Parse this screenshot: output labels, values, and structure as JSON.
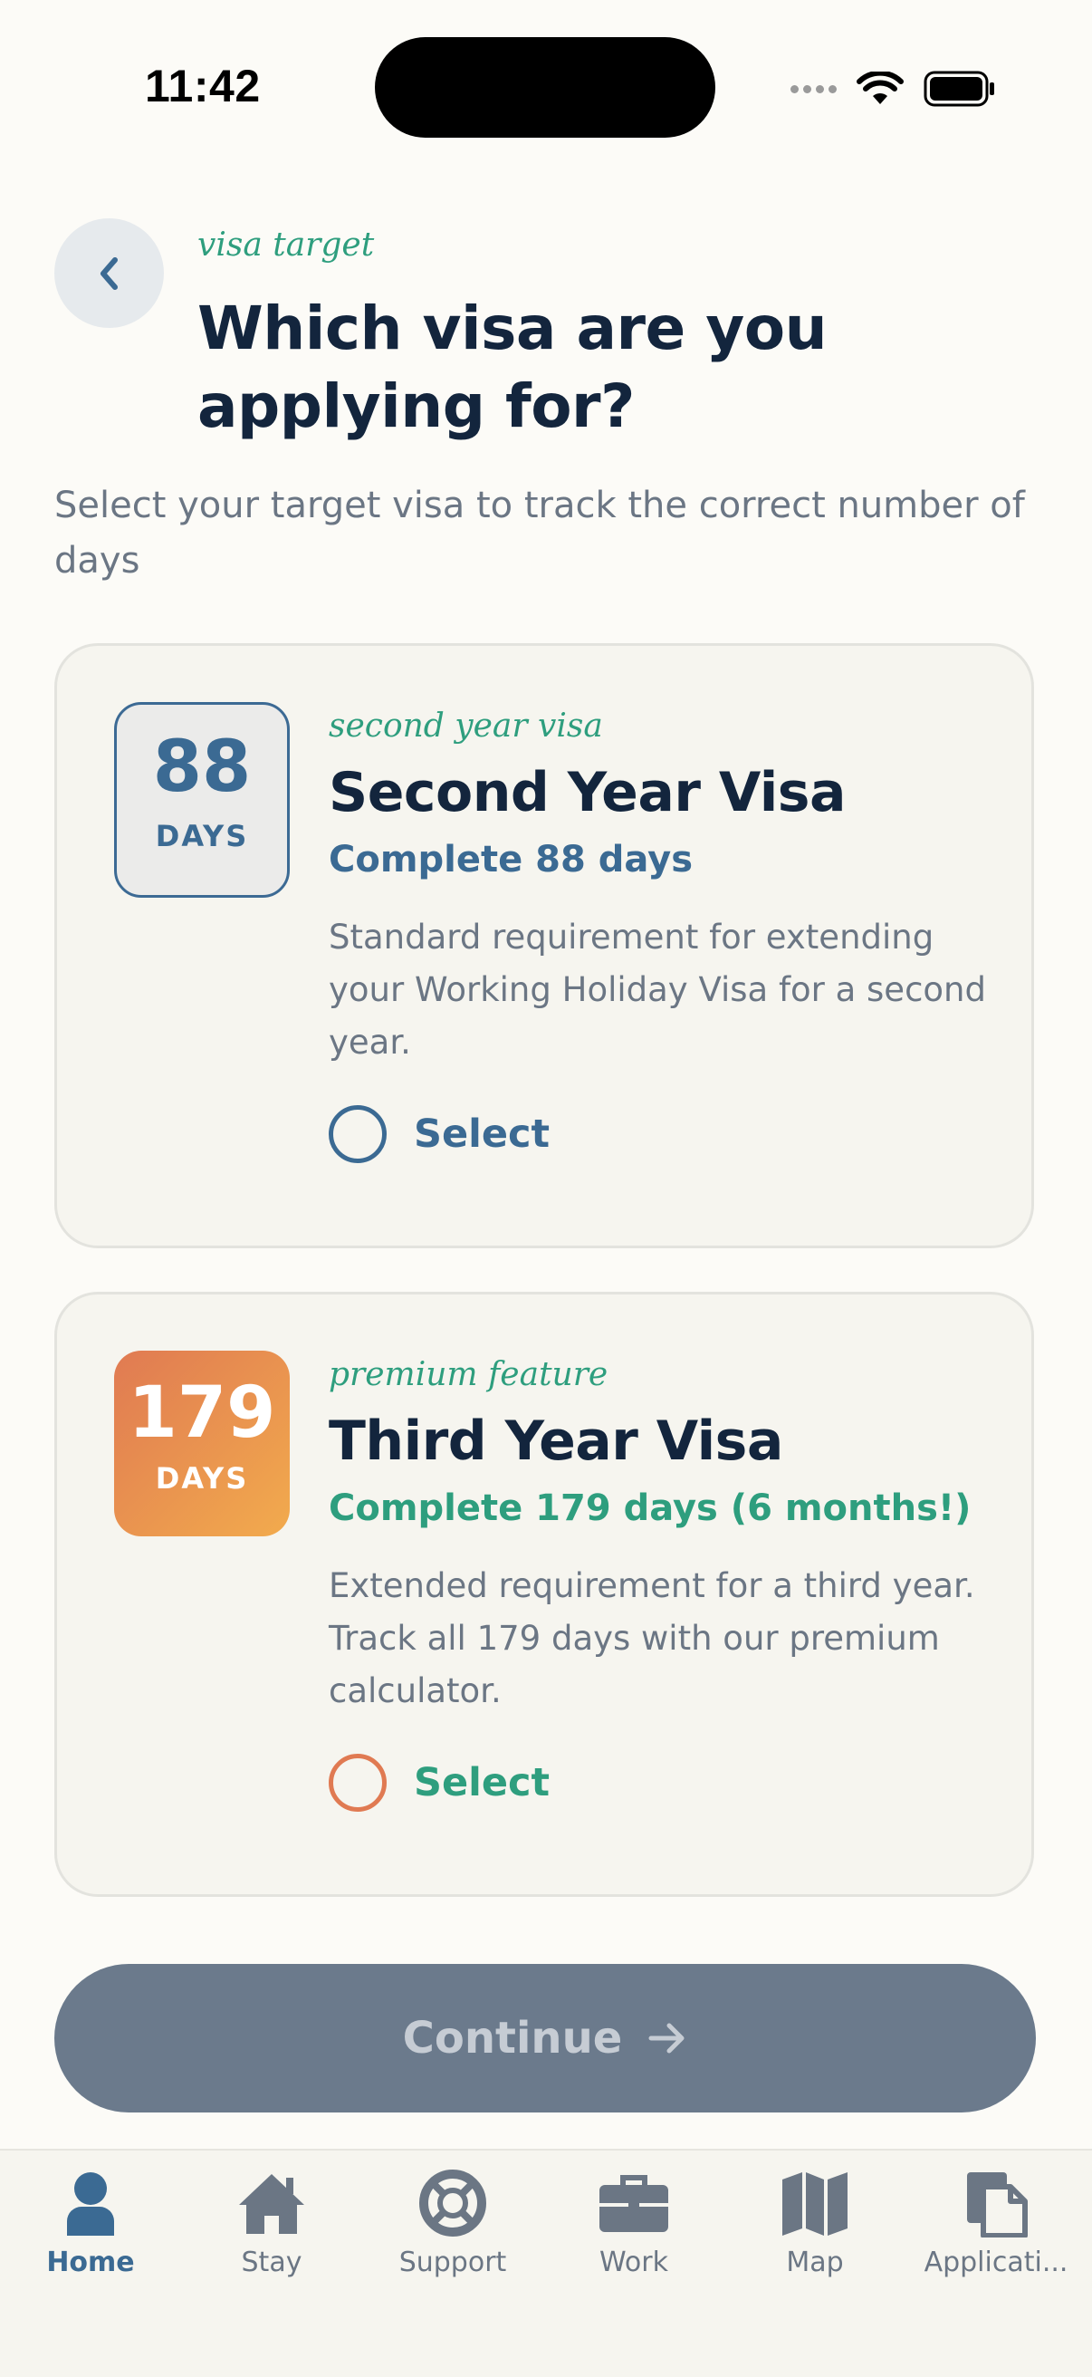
{
  "status_bar": {
    "time": "11:42"
  },
  "header": {
    "eyebrow": "visa target",
    "title": "Which visa are you applying for?",
    "subtitle": "Select your target visa to track the correct number of days"
  },
  "cards": [
    {
      "badge_number": "88",
      "badge_unit": "DAYS",
      "eyebrow": "second year visa",
      "title": "Second Year Visa",
      "requirement": "Complete 88 days",
      "description": "Standard requirement for extending your Working Holiday Visa for a second year.",
      "select_label": "Select",
      "selected": false
    },
    {
      "badge_number": "179",
      "badge_unit": "DAYS",
      "eyebrow": "premium feature",
      "title": "Third Year Visa",
      "requirement": "Complete 179 days (6 months!)",
      "description": "Extended requirement for a third year. Track all 179 days with our premium calculator.",
      "select_label": "Select",
      "selected": false
    }
  ],
  "continue_button": {
    "label": "Continue",
    "enabled": false
  },
  "tab_bar": {
    "active": "Home",
    "items": [
      {
        "label": "Home",
        "icon": "person-icon"
      },
      {
        "label": "Stay",
        "icon": "house-icon"
      },
      {
        "label": "Support",
        "icon": "lifebuoy-icon"
      },
      {
        "label": "Work",
        "icon": "briefcase-icon"
      },
      {
        "label": "Map",
        "icon": "map-icon"
      },
      {
        "label": "Applicati...",
        "icon": "documents-icon"
      }
    ]
  },
  "colors": {
    "background": "#fcfbf7",
    "primary": "#3b6a93",
    "accent_green": "#2e9e7e",
    "accent_orange": "#e07a52",
    "title": "#13253d",
    "muted": "#6b7684",
    "button_disabled": "#6b7a8c"
  }
}
